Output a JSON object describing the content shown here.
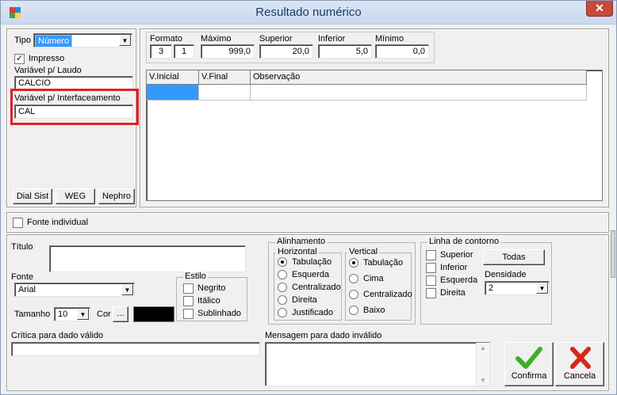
{
  "window": {
    "title": "Resultado numérico",
    "close_glyph": "✕"
  },
  "left_panel": {
    "tipo_label": "Tipo",
    "tipo_value": "Número",
    "impresso_label": "Impresso",
    "impresso_checked": true,
    "laudo_label": "Variável p/ Laudo",
    "laudo_value": "CALCIO",
    "interface_label": "Variável p/ Interfaceamento",
    "interface_value": "CAL",
    "buttons": [
      "Dial Sist",
      "WEG",
      "Nephro"
    ]
  },
  "format_panel": {
    "formato_label": "Formato",
    "formato_a": "3",
    "formato_b": "1",
    "maximo_label": "Máximo",
    "maximo_value": "999,0",
    "superior_label": "Superior",
    "superior_value": "20,0",
    "inferior_label": "Inferior",
    "inferior_value": "5,0",
    "minimo_label": "Mínimo",
    "minimo_value": "0,0"
  },
  "grid": {
    "columns": [
      "V.Inicial",
      "V.Final",
      "Observação"
    ]
  },
  "fonte_individual_label": "Fonte individual",
  "font_section": {
    "titulo_label": "Título",
    "titulo_value": "",
    "fonte_label": "Fonte",
    "fonte_value": "Arial",
    "tamanho_label": "Tamanho",
    "tamanho_value": "10",
    "cor_label": "Cor",
    "cor_button": "...",
    "cor_swatch": "#000000",
    "estilo_title": "Estilo",
    "estilo_options": [
      "Negrito",
      "Itálico",
      "Sublinhado"
    ]
  },
  "alinhamento": {
    "title": "Alinhamento",
    "horizontal_title": "Horizontal",
    "horizontal_options": [
      "Tabulação",
      "Esquerda",
      "Centralizado",
      "Direita",
      "Justificado"
    ],
    "horizontal_selected": 0,
    "vertical_title": "Vertical",
    "vertical_options": [
      "Tabulação",
      "Cima",
      "Centralizado",
      "Baixo"
    ],
    "vertical_selected": 0
  },
  "contorno": {
    "title": "Linha de contorno",
    "options": [
      "Superior",
      "Inferior",
      "Esquerda",
      "Direita"
    ],
    "todas_button": "Todas",
    "densidade_label": "Densidade",
    "densidade_value": "2"
  },
  "critica_label": "Crítica para dado válido",
  "critica_value": "",
  "mensagem_label": "Mensagem para dado inválido",
  "mensagem_value": "",
  "actions": {
    "confirma": "Confirma",
    "cancela": "Cancela"
  },
  "colors": {
    "highlight": "#e0202a",
    "selection": "#3399ff",
    "confirm": "#3fae2a",
    "cancel": "#d42a1a"
  }
}
